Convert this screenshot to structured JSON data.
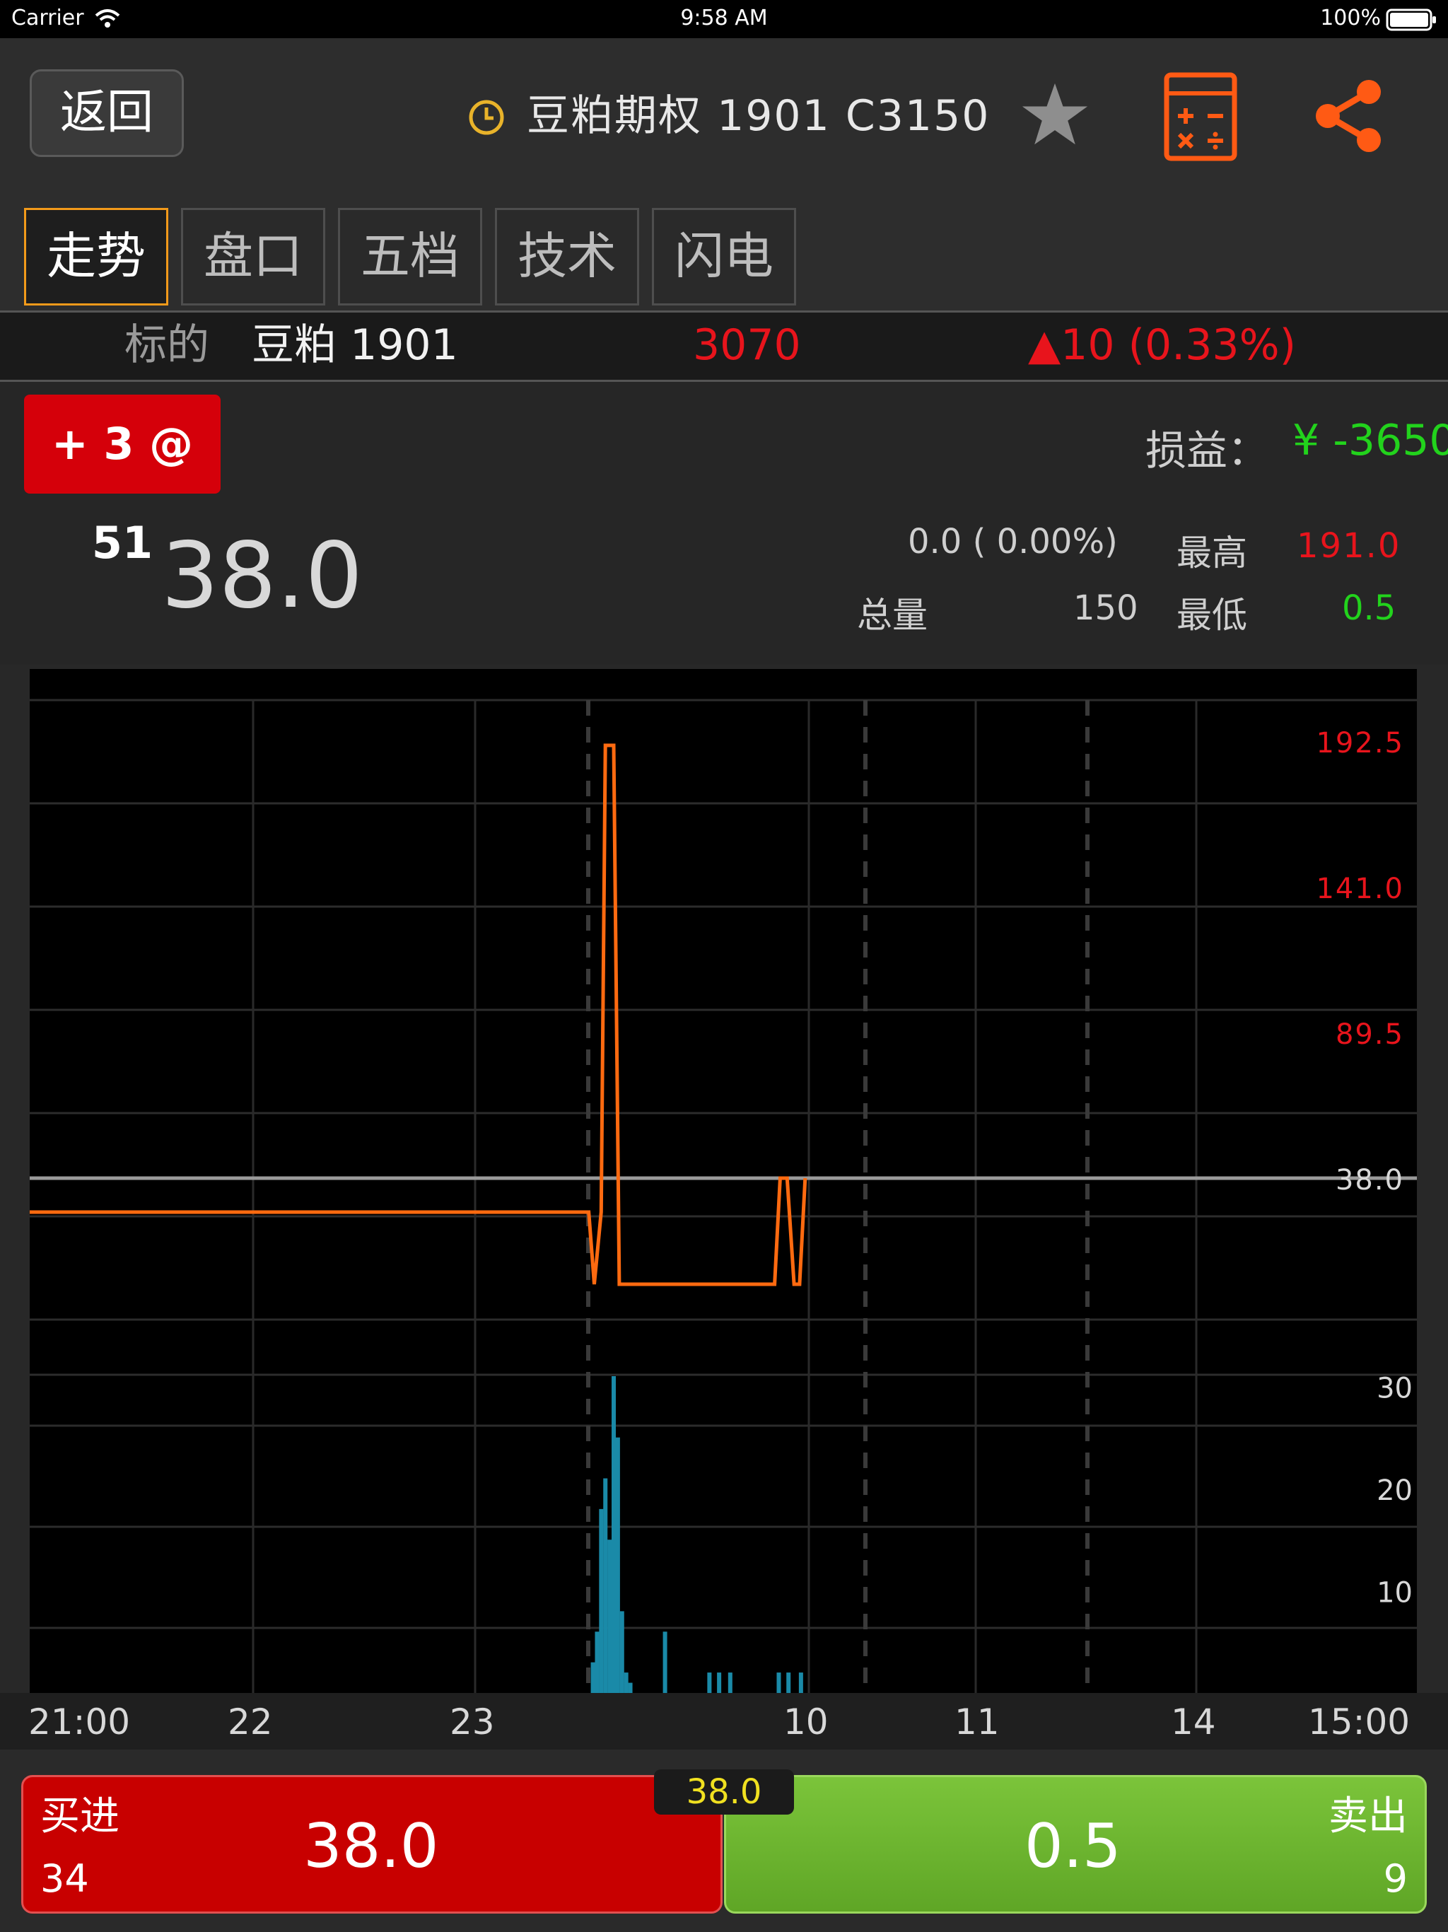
{
  "status_bar": {
    "carrier": "Carrier",
    "time": "9:58 AM",
    "battery": "100%"
  },
  "header": {
    "back_label": "返回",
    "title": "豆粕期权 1901 C3150"
  },
  "tabs": [
    {
      "label": "走势",
      "active": true
    },
    {
      "label": "盘口",
      "active": false
    },
    {
      "label": "五档",
      "active": false
    },
    {
      "label": "技术",
      "active": false
    },
    {
      "label": "闪电",
      "active": false
    }
  ],
  "underlying": {
    "label": "标的",
    "name": "豆粕 1901",
    "price": "3070",
    "change": "▲10 (0.33%)"
  },
  "position": {
    "badge": "+ 3 @ 51",
    "pnl_label": "损益：",
    "pnl_value": "¥ -3650"
  },
  "quote": {
    "last_price": "38.0",
    "change": "0.0 ( 0.00%)",
    "volume_label": "总量",
    "volume": "150",
    "high_label": "最高",
    "high": "191.0",
    "low_label": "最低",
    "low": "0.5"
  },
  "chart_data": {
    "type": "line",
    "price_axis": {
      "ticks": [
        "192.5",
        "141.0",
        "89.5",
        "38.0"
      ],
      "reference": 38.0,
      "ylim": [
        -14.0,
        218.0
      ]
    },
    "volume_axis": {
      "ticks": [
        "30",
        "20",
        "10"
      ],
      "ylim": [
        0,
        31
      ]
    },
    "x_tick_labels": [
      "21:00",
      "22",
      "23",
      "10",
      "11",
      "14",
      "15:00"
    ],
    "series": [
      {
        "values": [
          [
            0.0,
            26.0
          ],
          [
            0.403,
            26.0
          ],
          [
            0.407,
            0.5
          ],
          [
            0.412,
            26.0
          ],
          [
            0.415,
            191.0
          ],
          [
            0.421,
            191.0
          ],
          [
            0.425,
            0.5
          ],
          [
            0.537,
            0.5
          ],
          [
            0.541,
            38.0
          ],
          [
            0.546,
            38.0
          ],
          [
            0.551,
            0.5
          ],
          [
            0.555,
            0.5
          ],
          [
            0.559,
            38.0
          ]
        ]
      }
    ],
    "volume_bars": [
      [
        0.406,
        3
      ],
      [
        0.409,
        6
      ],
      [
        0.412,
        18
      ],
      [
        0.415,
        21
      ],
      [
        0.418,
        15
      ],
      [
        0.421,
        31
      ],
      [
        0.424,
        25
      ],
      [
        0.427,
        8
      ],
      [
        0.43,
        2
      ],
      [
        0.433,
        1
      ],
      [
        0.458,
        6
      ],
      [
        0.49,
        2
      ],
      [
        0.497,
        2
      ],
      [
        0.505,
        2
      ],
      [
        0.54,
        2
      ],
      [
        0.547,
        2
      ],
      [
        0.556,
        2
      ]
    ]
  },
  "trade": {
    "buy_label": "买进",
    "buy_price": "38.0",
    "buy_qty": "34",
    "mid_price": "38.0",
    "sell_label": "卖出",
    "sell_price": "0.5",
    "sell_qty": "9"
  },
  "colors": {
    "buy": "#c80000",
    "sell": "#6ab52e",
    "line": "#ff6a10",
    "volume": "#1a8aa8",
    "accent": "#f29a1a"
  }
}
